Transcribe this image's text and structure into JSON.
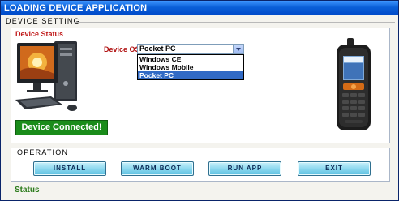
{
  "window": {
    "title": "LOADING DEVICE APPLICATION"
  },
  "sections": {
    "device_setting": "DEVICE SETTING",
    "operation": "OPERATION"
  },
  "device_status": {
    "title": "Device Status",
    "os_label": "Device OS",
    "os_selected": "Pocket PC",
    "os_options": [
      "Windows CE",
      "Windows Mobile",
      "Pocket PC"
    ],
    "connection": "Device Connected!"
  },
  "buttons": {
    "install": "INSTALL",
    "warm_boot": "WARM BOOT",
    "run_app": "RUN APP",
    "exit": "EXIT"
  },
  "status": {
    "title": "Status"
  },
  "icons": {
    "computer": "desktop-computer-icon",
    "phone": "mobile-device-icon",
    "dropdown": "chevron-down-icon"
  },
  "colors": {
    "titlebar": "#0a5fd8",
    "device_status_title": "#c01818",
    "connected_bg": "#1a8c1a",
    "status_title": "#2a7a1a",
    "button_bg": "#8ed8ef",
    "selected_option": "#316ac5"
  }
}
